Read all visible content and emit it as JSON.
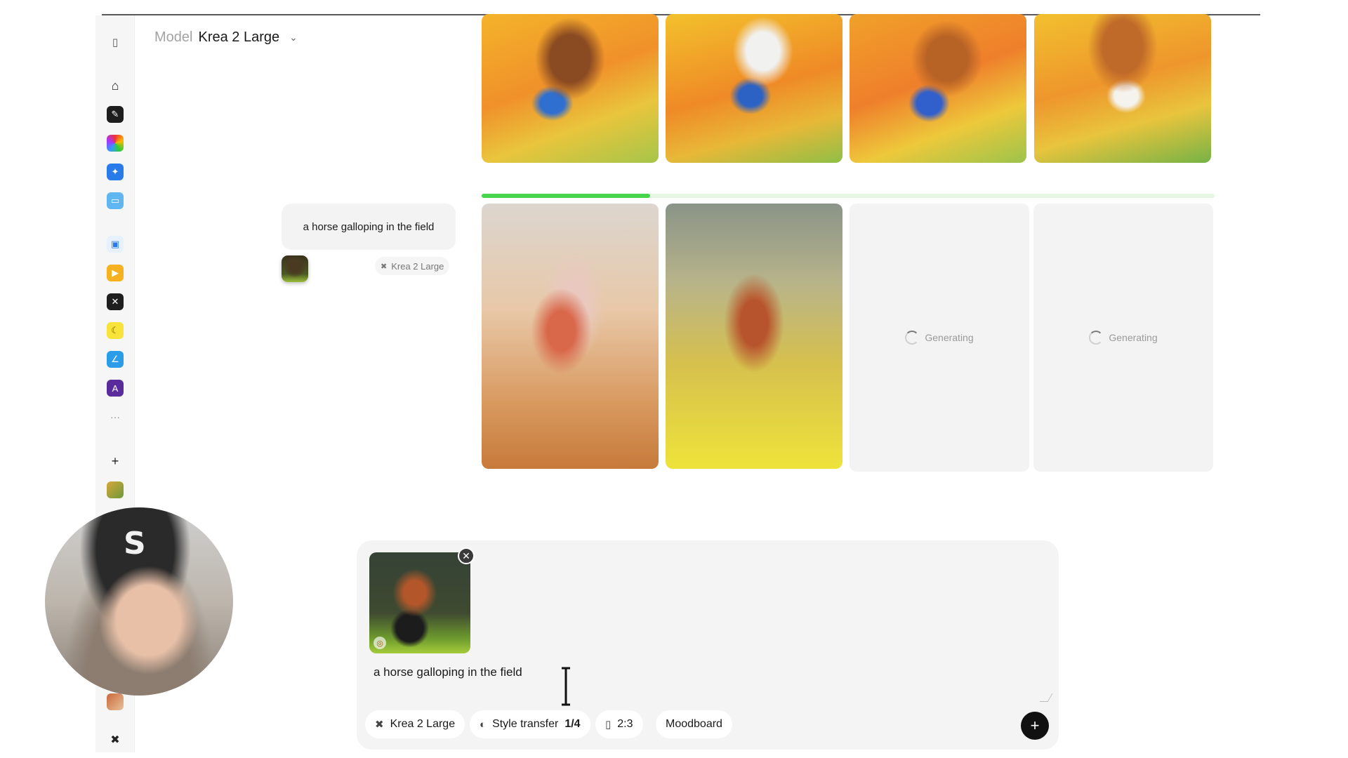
{
  "header": {
    "model_label": "Model",
    "model_value": "Krea 2 Large"
  },
  "prompt_history": {
    "prompt_text": "a horse galloping in the field",
    "model_chip": "Krea 2 Large"
  },
  "generation": {
    "progress": 0.23,
    "pending_label": "Generating"
  },
  "composer": {
    "prompt_value": "a horse galloping in the field",
    "pills": {
      "model": "Krea 2 Large",
      "style_transfer": "Style transfer",
      "style_transfer_count": "1/4",
      "aspect_ratio": "2:3",
      "moodboard": "Moodboard"
    }
  },
  "webcam": {
    "cap_letter": "S"
  },
  "colors": {
    "progress": "#47d64b",
    "send_button": "#111111"
  },
  "icons": {
    "rail": [
      "sidebar-toggle-icon",
      "home-icon",
      "pen-icon",
      "color-wheel-icon",
      "enhance-icon",
      "folder-icon",
      "image-edit-icon",
      "video-icon",
      "realtime-icon",
      "banana-icon",
      "edit-icon",
      "app-a-icon",
      "more-icon",
      "plus-icon",
      "krea-logo-icon"
    ]
  }
}
